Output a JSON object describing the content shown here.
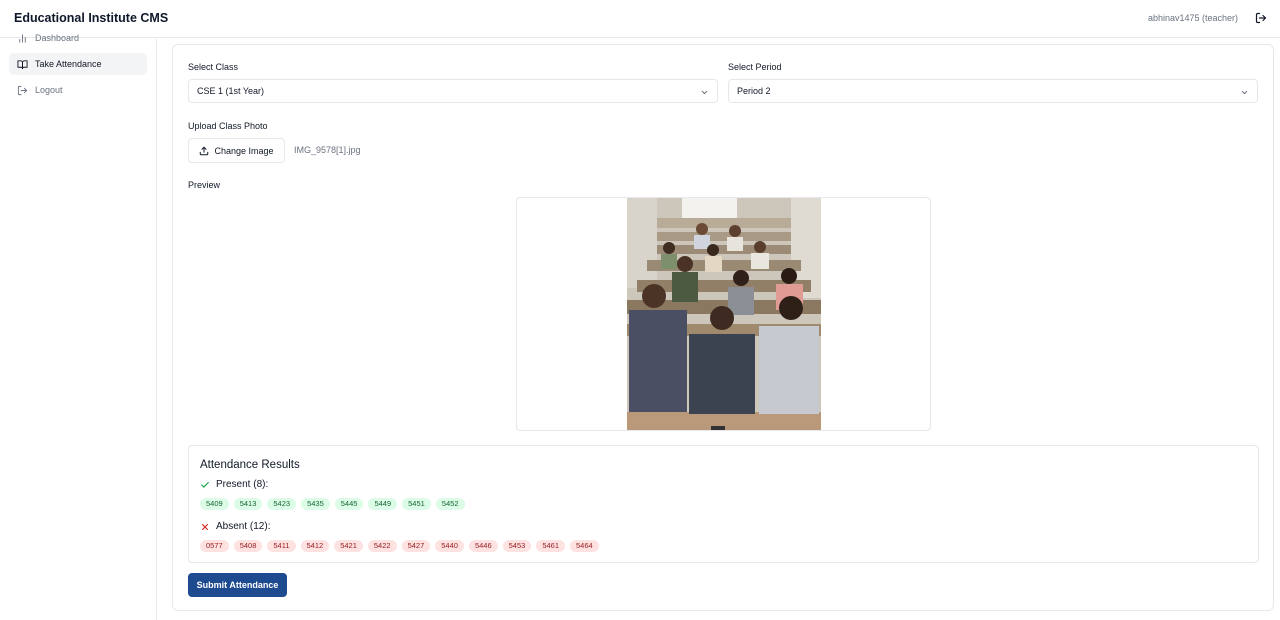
{
  "app": {
    "title": "Educational Institute CMS",
    "user": "abhinav1475 (teacher)"
  },
  "sidebar": {
    "items": [
      {
        "label": "Dashboard",
        "icon": "bar-chart-icon"
      },
      {
        "label": "Take Attendance",
        "icon": "book-open-icon",
        "active": true
      },
      {
        "label": "Logout",
        "icon": "logout-icon"
      }
    ]
  },
  "form": {
    "class_label": "Select Class",
    "class_value": "CSE 1 (1st Year)",
    "period_label": "Select Period",
    "period_value": "Period 2",
    "upload_label": "Upload Class Photo",
    "change_button": "Change Image",
    "filename": "IMG_9578[1].jpg",
    "preview_label": "Preview"
  },
  "results": {
    "title": "Attendance Results",
    "present_label": "Present (8):",
    "present": [
      "5409",
      "5413",
      "5423",
      "5435",
      "5445",
      "5449",
      "5451",
      "5452"
    ],
    "absent_label": "Absent (12):",
    "absent": [
      "0577",
      "5408",
      "5411",
      "5412",
      "5421",
      "5422",
      "5427",
      "5440",
      "5446",
      "5453",
      "5461",
      "5464"
    ]
  },
  "submit_label": "Submit Attendance",
  "colors": {
    "primary": "#1e4b8f",
    "present_bg": "#dcfce7",
    "present_text": "#166534",
    "absent_bg": "#fee2e2",
    "absent_text": "#991b1b"
  }
}
